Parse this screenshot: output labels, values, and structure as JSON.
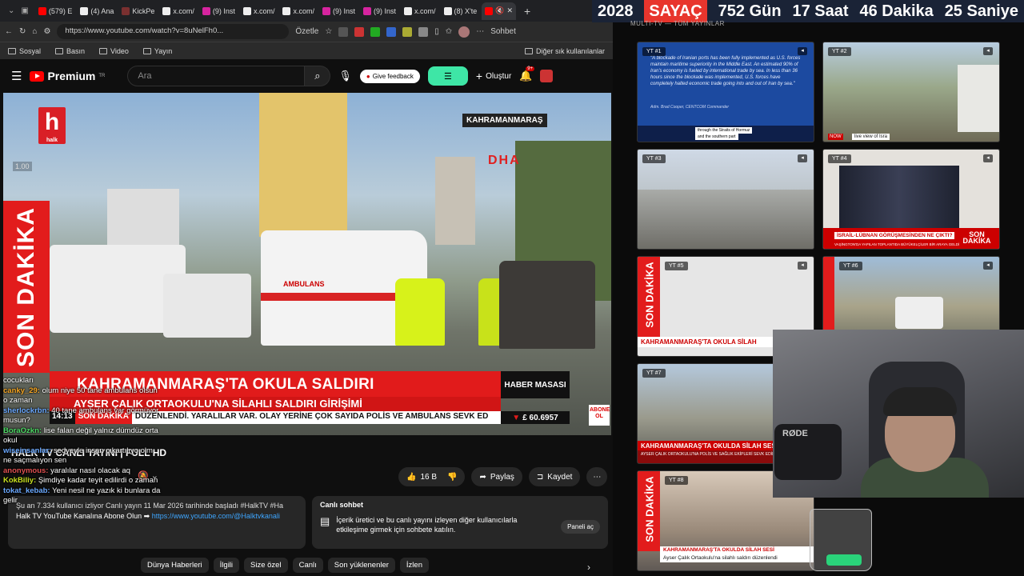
{
  "browser": {
    "tabs": [
      {
        "label": "(579) E",
        "color": "#ff0000"
      },
      {
        "label": "(4) Ana",
        "color": "#ffffff"
      },
      {
        "label": "KickPe",
        "color": "#5a2a2a"
      },
      {
        "label": "x.com/",
        "color": "#ffffff"
      },
      {
        "label": "(9) Inst",
        "color": "#d6249f"
      },
      {
        "label": "x.com/",
        "color": "#ffffff"
      },
      {
        "label": "x.com/",
        "color": "#ffffff"
      },
      {
        "label": "(9) Inst",
        "color": "#d6249f"
      },
      {
        "label": "(9) Inst",
        "color": "#d6249f"
      },
      {
        "label": "x.com/",
        "color": "#ffffff"
      },
      {
        "label": "(8) X'te",
        "color": "#ffffff"
      }
    ],
    "url": "https://www.youtube.com/watch?v=8uNelFh0...",
    "summarize": "Özetle",
    "sohbet": "Sohbet",
    "bookmarks": [
      "Sosyal",
      "Basın",
      "Video",
      "Yayın"
    ],
    "other_bookmarks": "Diğer sık kullanılanlar"
  },
  "youtube": {
    "logo": "Premium",
    "logo_sup": "TR",
    "search_placeholder": "Ara",
    "feedback": "Give feedback",
    "create": "Oluştur",
    "notif_count": "9+"
  },
  "video": {
    "channel_logo": "h",
    "channel_sub": "halk",
    "speed": "1.00",
    "location": "KAHRAMANMARAŞ",
    "agency": "DHA",
    "son_dakika": "SON DAKİKA",
    "headline": "KAHRAMANMARAŞ'TA OKULA SALDIRI",
    "subheadline": "AYSER ÇALIK ORTAOKULU'NA SİLAHLI SALDIRI GİRİŞİMİ",
    "ticker_time": "14:13",
    "ticker_tag": "SON DAKİKA",
    "ticker_text": "DÜZENLENDİ. YARALILAR VAR. OLAY YERİNE ÇOK SAYIDA POLİS VE AMBULANS SEVK ED",
    "desk": "HABER MASASI",
    "price_label": "£ 60.6957",
    "abone": "ABONE OL",
    "ambulance_text": "AMBULANS"
  },
  "below_video": {
    "title": "HALK TV CANLI YAYINI | FULL HD",
    "likes": "16 B",
    "share": "Paylaş",
    "save": "Kaydet",
    "description_line1": "Şu an 7.334 kullanıcı izliyor  Canlı yayın 11 Mar 2026 tarihinde başladı  #HalkTV #Ha",
    "description_line2": "Halk TV YouTube Kanalına Abone Olun ➡",
    "description_link": "https://www.youtube.com/@Halktvkanali",
    "live_chat_title": "Canlı sohbet",
    "live_chat_text": "İçerik üretici ve bu canlı yayını izleyen diğer kullanıcılarla etkileşime girmek için sohbete katılın.",
    "live_chat_btn": "Paneli aç",
    "chips": [
      "Dünya Haberleri",
      "İlgili",
      "Size özel",
      "Canlı",
      "Son yüklenenler",
      "İzlen"
    ]
  },
  "chat_overlay": [
    {
      "user": "",
      "text": "cocukları"
    },
    {
      "user": "canky_29:",
      "text": "olum niye 50 tane ambulans olsun o zaman"
    },
    {
      "user": "sherlockrbn:",
      "text": "40 tane ambulans var görmüyor musun?"
    },
    {
      "user": "BoraOzkn:",
      "text": "lise falan değil yalnız dümdüz orta okul"
    },
    {
      "user": "wiseinsanlar:",
      "text": "sedyeyle insan çıkartılıyo olm ne saçmalıyon sen"
    },
    {
      "user": "anonymous:",
      "text": "yaralılar nasıl olacak aq"
    },
    {
      "user": "KokBiliy:",
      "text": "Şimdiye kadar teyit edilirdi o zaman"
    },
    {
      "user": "tokat_kebab:",
      "text": "Yeni nesil ne yazık ki bunlara da gelir"
    }
  ],
  "counter": {
    "year": "2028",
    "label": "SAYAÇ",
    "days": "752 Gün",
    "hours": "17 Saat",
    "minutes": "46 Dakika",
    "seconds": "25 Saniye"
  },
  "multitv": {
    "title": "MULTI-TV — TÜM YAYINLAR",
    "tiles": [
      "YT #1",
      "YT #2",
      "YT #3",
      "YT #4",
      "YT #5",
      "YT #6",
      "YT #7",
      "YT #8"
    ],
    "tile1_quote": "\"A blockade of Iranian ports has been fully implemented as U.S. forces maintain maritime superiority in the Middle East. An estimated 90% of Iran's economy is fueled by international trade by sea. In less than 36 hours since the blockade was implemented, U.S. forces have completely halted economic trade going into and out of Iran by sea.\"",
    "tile1_source": "Adm. Brad Cooper, CENTCOM Commander",
    "tile1_cap1": "through the Straits of Hormuz",
    "tile1_cap2": "and the southern part",
    "tile2_now": "NOW",
    "tile2_caption": "live view of Isra",
    "tile4_question": "İSRAİL-LÜBNAN GÖRÜŞMESİNDEN NE ÇIKTI?",
    "tile4_sub": "VAŞİNGTON'DA YAPILAN TOPLANTIDA BÜYÜKELÇİLER BİR ARAYA GELDİ",
    "tile4_sd": "SON DAKİKA",
    "tile5_band": "KAHRAMANMARAŞ'TA OKULA SİLAH",
    "tile7_band": "KAHRAMANMARAŞ'TA OKULDA SİLAH SESİ",
    "tile7_sub": "AYSER ÇALIK ORTAOKULU'NA POLİS VE SAĞLIK EKİPLERİ SEVK EDİLDİ",
    "tile8_band1": "KAHRAMANMARAŞ'TA OKULDA SİLAH SESİ",
    "tile8_band2": "Ayser Çalık Ortaokulu'na silahlı saldırı düzenlendi",
    "son_dakika": "SON DAKİKA"
  },
  "webcam": {
    "mic_brand": "RØDE"
  }
}
